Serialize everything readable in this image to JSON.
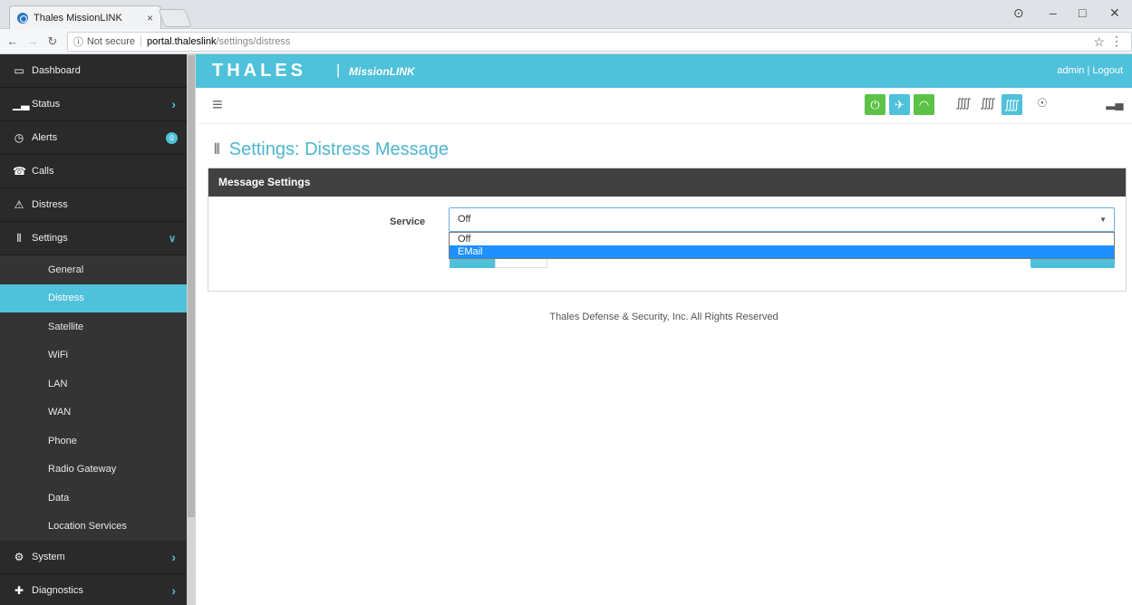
{
  "browser": {
    "tab_title": "Thales MissionLINK",
    "tab_close": "×",
    "not_secure": "Not secure",
    "url_host": "portal.thaleslink",
    "url_path": "/settings/distress"
  },
  "header": {
    "brand": "THALES",
    "separator": "|",
    "product": "MissionLINK",
    "user_links": "admin | Logout"
  },
  "sidebar": {
    "items": [
      {
        "label": "Dashboard"
      },
      {
        "label": "Status"
      },
      {
        "label": "Alerts",
        "badge": "0"
      },
      {
        "label": "Calls"
      },
      {
        "label": "Distress"
      },
      {
        "label": "Settings"
      },
      {
        "label": "System"
      },
      {
        "label": "Diagnostics"
      }
    ],
    "settings_sub": [
      {
        "label": "General"
      },
      {
        "label": "Distress"
      },
      {
        "label": "Satellite"
      },
      {
        "label": "WiFi"
      },
      {
        "label": "LAN"
      },
      {
        "label": "WAN"
      },
      {
        "label": "Phone"
      },
      {
        "label": "Radio Gateway"
      },
      {
        "label": "Data"
      },
      {
        "label": "Location Services"
      }
    ]
  },
  "page": {
    "title": "Settings: Distress Message",
    "panel_title": "Message Settings",
    "service_label": "Service",
    "service_value": "Off",
    "service_options": [
      "Off",
      "EMail"
    ],
    "service_highlighted": "EMail"
  },
  "footer": {
    "text": "Thales Defense & Security, Inc. All Rights Reserved"
  },
  "colors": {
    "accent": "#4fc1da",
    "sidebar_bg": "#2a2a2a",
    "panel_header": "#414141",
    "status_green": "#5cc247",
    "dropdown_highlight": "#1e90ff"
  }
}
